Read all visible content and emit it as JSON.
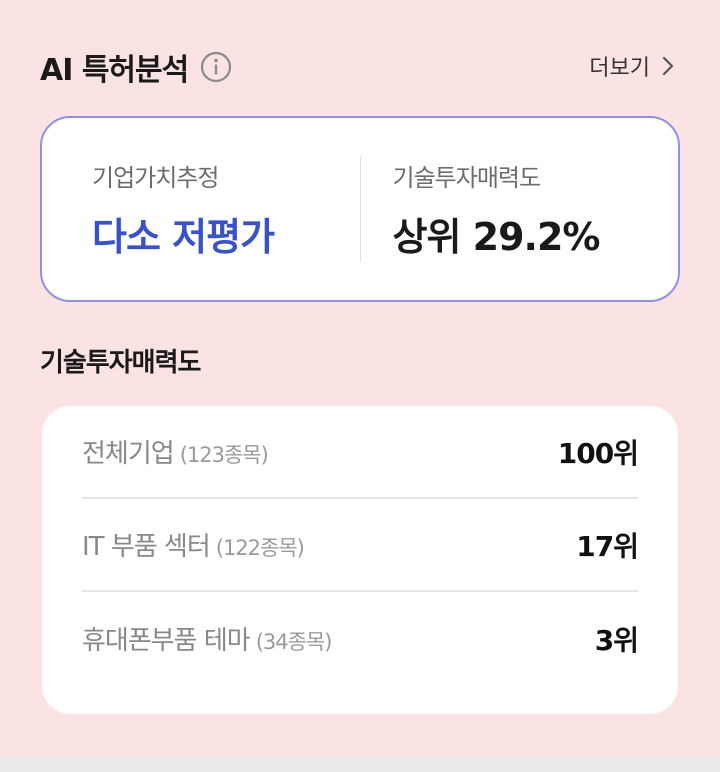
{
  "header": {
    "title": "AI 특허분석",
    "more_label": "더보기"
  },
  "summary": {
    "left": {
      "label": "기업가치추정",
      "value": "다소 저평가"
    },
    "right": {
      "label": "기술투자매력도",
      "value": "상위 29.2%"
    }
  },
  "section": {
    "title": "기술투자매력도"
  },
  "rankings": [
    {
      "name": "전체기업",
      "count": "(123종목)",
      "rank": "100위"
    },
    {
      "name": "IT 부품 섹터",
      "count": "(122종목)",
      "rank": "17위"
    },
    {
      "name": "휴대폰부품 테마",
      "count": "(34종목)",
      "rank": "3위"
    }
  ],
  "colors": {
    "background": "#fce3e3",
    "accent_blue": "#3a52c7",
    "card_border": "#8e90e8"
  },
  "icons": {
    "info": "info-circle-icon",
    "more": "chevron-right-icon"
  }
}
